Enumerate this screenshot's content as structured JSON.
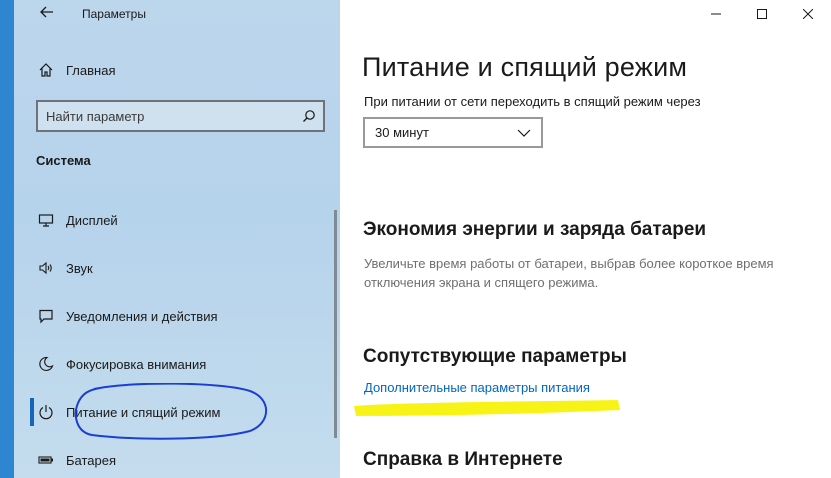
{
  "window": {
    "title": "Параметры",
    "back_icon": "arrow-left-icon",
    "controls": [
      "minimize-icon",
      "maximize-icon",
      "close-icon"
    ]
  },
  "sidebar": {
    "home_label": "Главная",
    "search_placeholder": "Найти параметр",
    "section_heading": "Система",
    "items": [
      {
        "label": "Дисплей",
        "icon": "monitor-icon"
      },
      {
        "label": "Звук",
        "icon": "speaker-icon"
      },
      {
        "label": "Уведомления и действия",
        "icon": "notification-icon"
      },
      {
        "label": "Фокусировка внимания",
        "icon": "moon-icon"
      },
      {
        "label": "Питание и спящий режим",
        "icon": "power-icon",
        "selected": true
      },
      {
        "label": "Батарея",
        "icon": "battery-icon"
      }
    ]
  },
  "main": {
    "title": "Питание и спящий режим",
    "sleep_label": "При питании от сети переходить в спящий режим через",
    "sleep_value": "30 минут",
    "energy_heading": "Экономия энергии и заряда батареи",
    "energy_desc": "Увеличьте время работы от батареи, выбрав более короткое время отключения экрана и спящего режима.",
    "related_heading": "Сопутствующие параметры",
    "related_link": "Дополнительные параметры питания",
    "help_heading": "Справка в Интернете"
  },
  "colors": {
    "sidebar_bg": "#bcd6ec",
    "accent": "#1565b8",
    "link": "#0067c0",
    "annotation_circle": "#1c3fd1",
    "annotation_highlight": "#f7f20a"
  }
}
